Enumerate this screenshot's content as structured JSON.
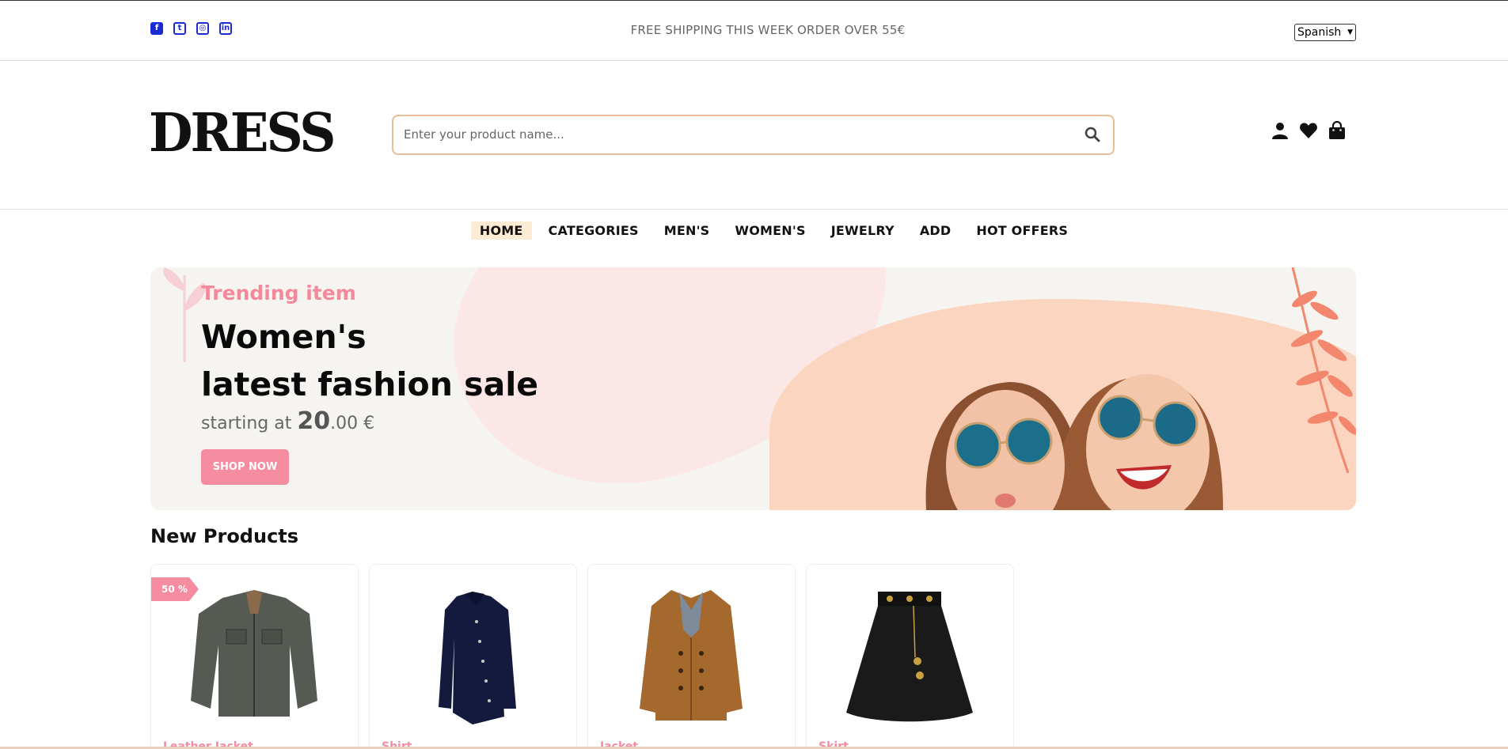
{
  "topbar": {
    "socials": [
      {
        "name": "facebook-icon",
        "glyph": "f"
      },
      {
        "name": "twitter-icon",
        "glyph": "t"
      },
      {
        "name": "instagram-icon",
        "glyph": "◎"
      },
      {
        "name": "linkedin-icon",
        "glyph": "in"
      }
    ],
    "shipping_text": "FREE SHIPPING THIS WEEK ORDER OVER 55€",
    "language": "Spanish"
  },
  "header": {
    "logo": "DRESS",
    "search_placeholder": "Enter your product name...",
    "icons": [
      "user-icon",
      "heart-icon",
      "bag-icon"
    ]
  },
  "nav": {
    "items": [
      "HOME",
      "CATEGORIES",
      "MEN'S",
      "WOMEN'S",
      "JEWELRY",
      "ADD",
      "HOT OFFERS"
    ],
    "active": "HOME"
  },
  "banner": {
    "subtitle": "Trending item",
    "title_line1": "Women's",
    "title_line2": "latest fashion sale",
    "price_prefix": "starting at",
    "price_int": "20",
    "price_rest": ".00 €",
    "button": "SHOP NOW"
  },
  "new_products": {
    "title": "New Products",
    "items": [
      {
        "badge": "50 %",
        "category": "Leather Jacket",
        "image": "jacket-olive"
      },
      {
        "badge": "",
        "category": "Shirt",
        "image": "shirt-navy"
      },
      {
        "badge": "",
        "category": "Jacket",
        "image": "coat-brown"
      },
      {
        "badge": "",
        "category": "Skirt",
        "image": "skirt-black"
      }
    ]
  },
  "colors": {
    "accent_pink": "#f58ca0",
    "search_border": "#e6bf98",
    "social_blue": "#1a2bd6"
  }
}
